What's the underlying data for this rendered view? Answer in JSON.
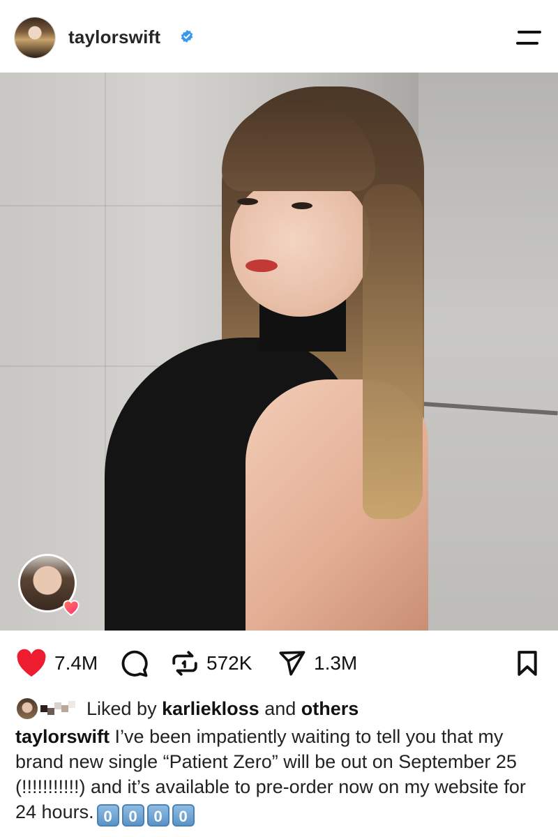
{
  "header": {
    "username": "taylorswift",
    "verified_icon": "verified-badge-icon",
    "menu_icon": "hamburger-menu-icon",
    "accent_color": "#3897f0"
  },
  "post": {
    "image_icon": "post-photo",
    "tagged_user_icon": "tagged-user-avatar",
    "tag_heart_color": "#ff3b6b"
  },
  "actions": {
    "like_count": "7.4M",
    "like_color": "#ed1c2e",
    "comment_icon": "comment-bubble-icon",
    "repost_count": "572K",
    "share_count": "1.3M",
    "save_icon": "bookmark-icon"
  },
  "liked_by": {
    "prefix": "Liked by",
    "user": "karliekloss",
    "middle": "and",
    "suffix": "others"
  },
  "caption": {
    "username": "taylorswift",
    "text": "I’ve been impatiently waiting to tell you that my brand new single “Patient Zero” will be out on September 25 (!!!!!!!!!!!) and it’s available to pre-order now on my website for 24 hours.",
    "keycaps": [
      "0",
      "0",
      "0",
      "0"
    ]
  }
}
